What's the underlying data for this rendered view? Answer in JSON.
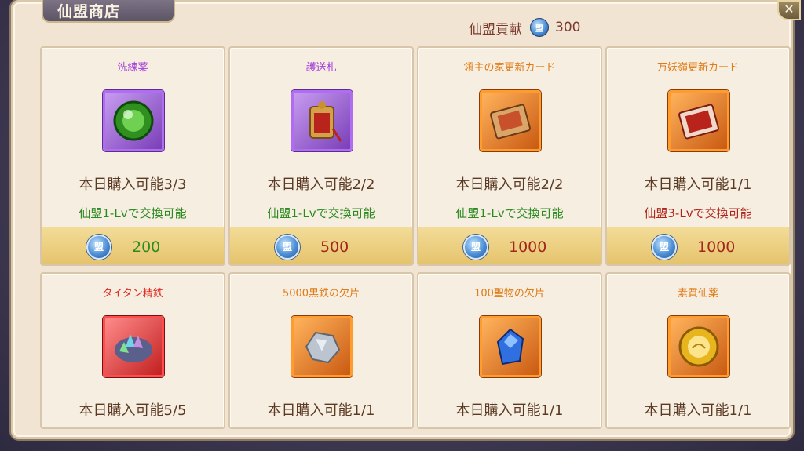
{
  "window": {
    "title": "仙盟商店",
    "close_label": "✕"
  },
  "currency": {
    "label": "仙盟貢献",
    "value": "300",
    "icon": "alliance-coin-icon"
  },
  "coin_glyph": "盟",
  "items": [
    {
      "name": "洗練薬",
      "name_color": "#a23bd8",
      "limit": "本日購入可能3/3",
      "requirement": "仙盟1-Lvで交換可能",
      "req_color": "#2a8a1f",
      "price": "200",
      "price_color": "#2f8a1f",
      "rarity": "purple",
      "icon": "green-orb-icon"
    },
    {
      "name": "護送札",
      "name_color": "#a23bd8",
      "limit": "本日購入可能2/2",
      "requirement": "仙盟1-Lvで交換可能",
      "req_color": "#2a8a1f",
      "price": "500",
      "price_color": "#a3261c",
      "rarity": "purple",
      "icon": "escort-tag-icon"
    },
    {
      "name": "領主の家更新カード",
      "name_color": "#e07a14",
      "limit": "本日購入可能2/2",
      "requirement": "仙盟1-Lvで交換可能",
      "req_color": "#2a8a1f",
      "price": "1000",
      "price_color": "#a3261c",
      "rarity": "orange",
      "icon": "refresh-card-icon"
    },
    {
      "name": "万妖嶺更新カード",
      "name_color": "#e07a14",
      "limit": "本日購入可能1/1",
      "requirement": "仙盟3-Lvで交換可能",
      "req_color": "#b0241a",
      "price": "1000",
      "price_color": "#a3261c",
      "rarity": "orange",
      "icon": "monster-card-icon"
    },
    {
      "name": "タイタン精鉄",
      "name_color": "#e0261c",
      "limit": "本日購入可能5/5",
      "rarity": "red",
      "icon": "crystal-ore-icon"
    },
    {
      "name": "5000黒鉄の欠片",
      "name_color": "#e07a14",
      "limit": "本日購入可能1/1",
      "rarity": "orange",
      "icon": "iron-shard-icon"
    },
    {
      "name": "100聖物の欠片",
      "name_color": "#e07a14",
      "limit": "本日購入可能1/1",
      "rarity": "orange",
      "icon": "blue-gem-icon"
    },
    {
      "name": "素質仙薬",
      "name_color": "#e07a14",
      "limit": "本日購入可能1/1",
      "rarity": "orange",
      "icon": "golden-elixir-icon"
    }
  ]
}
